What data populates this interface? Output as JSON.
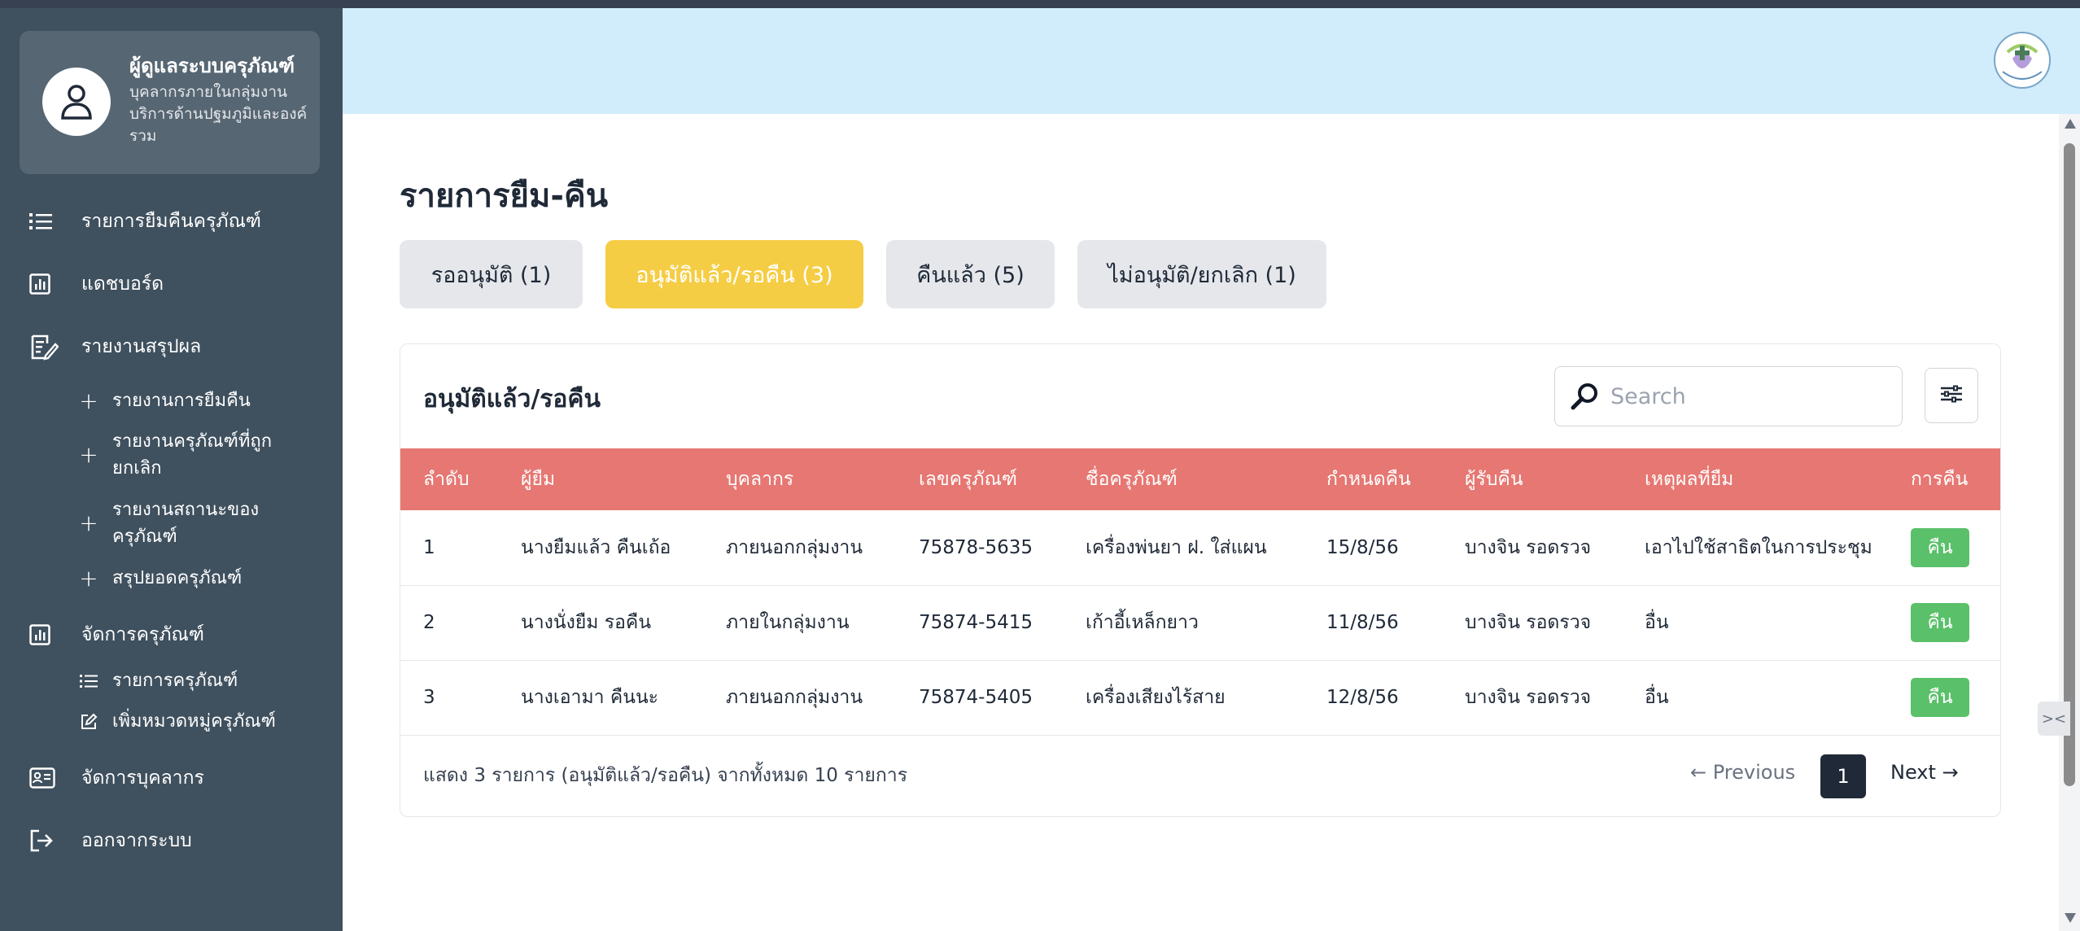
{
  "sidebar": {
    "profile": {
      "name": "ผู้ดูแลระบบครุภัณฑ์",
      "subtitle": "บุคลากรภายในกลุ่มงานบริการด้านปฐมภูมิและองค์รวม"
    },
    "items": [
      {
        "label": "รายการยืมคืนครุภัณฑ์",
        "icon": "list-icon"
      },
      {
        "label": "แดชบอร์ด",
        "icon": "chart-icon"
      },
      {
        "label": "รายงานสรุปผล",
        "icon": "report-icon"
      },
      {
        "label": "จัดการครุภัณฑ์",
        "icon": "chart-icon"
      },
      {
        "label": "จัดการบุคลากร",
        "icon": "id-card-icon"
      },
      {
        "label": "ออกจากระบบ",
        "icon": "logout-icon"
      }
    ],
    "report_subitems": [
      "รายงานการยืมคืน",
      "รายงานครุภัณฑ์ที่ถูกยกเลิก",
      "รายงานสถานะของครุภัณฑ์",
      "สรุปยอดครุภัณฑ์"
    ],
    "equipment_subitems": [
      "รายการครุภัณฑ์",
      "เพิ่มหมวดหมู่ครุภัณฑ์"
    ]
  },
  "main": {
    "title": "รายการยืม-คืน",
    "tabs": [
      {
        "label": "รออนุมัติ (1)",
        "active": false
      },
      {
        "label": "อนุมัติแล้ว/รอคืน (3)",
        "active": true
      },
      {
        "label": "คืนแล้ว (5)",
        "active": false
      },
      {
        "label": "ไม่อนุมัติ/ยกเลิก (1)",
        "active": false
      }
    ],
    "card_title": "อนุมัติแล้ว/รอคืน",
    "search_placeholder": "Search",
    "table": {
      "columns": [
        "ลำดับ",
        "ผู้ยืม",
        "บุคลากร",
        "เลขครุภัณฑ์",
        "ชื่อครุภัณฑ์",
        "กำหนดคืน",
        "ผู้รับคืน",
        "เหตุผลที่ยืม",
        "การคืน"
      ],
      "rows": [
        [
          "1",
          "นางยืมแล้ว คืนเถ้อ",
          "ภายนอกกลุ่มงาน",
          "75878-5635",
          "เครื่องพ่นยา ฝ. ใส่แผน",
          "15/8/56",
          "บางจิน รอดรวจ",
          "เอาไปใช้สาธิตในการประชุม",
          "คืน"
        ],
        [
          "2",
          "นางนั่งยืม รอคืน",
          "ภายในกลุ่มงาน",
          "75874-5415",
          "เก้าอี้เหล็กยาว",
          "11/8/56",
          "บางจิน รอดรวจ",
          "อื่น",
          "คืน"
        ],
        [
          "3",
          "นางเอามา คืนนะ",
          "ภายนอกกลุ่มงาน",
          "75874-5405",
          "เครื่องเสียงไร้สาย",
          "12/8/56",
          "บางจิน รอดรวจ",
          "อื่น",
          "คืน"
        ]
      ]
    },
    "footer": {
      "summary": "แสดง 3 รายการ (อนุมัติแล้ว/รอคืน) จากทั้งหมด 10 รายการ",
      "prev": "← Previous",
      "page": "1",
      "next": "Next →"
    }
  },
  "colors": {
    "sidebar": "#3f505e",
    "header": "#d1ecfa",
    "active_tab": "#f5cd45",
    "table_header": "#e67772",
    "return_button": "#5ac06a"
  }
}
